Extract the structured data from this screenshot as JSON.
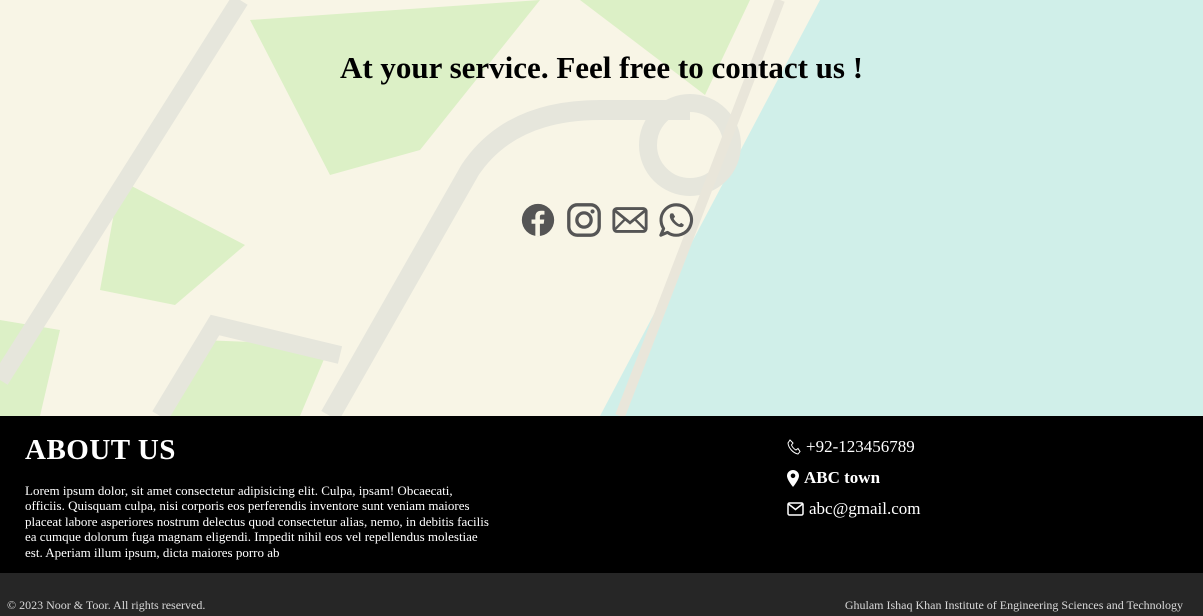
{
  "hero": {
    "title": "At your service. Feel free to contact us !"
  },
  "social": [
    {
      "name": "facebook",
      "icon": "facebook-icon"
    },
    {
      "name": "instagram",
      "icon": "instagram-icon"
    },
    {
      "name": "email",
      "icon": "envelope-icon"
    },
    {
      "name": "whatsapp",
      "icon": "whatsapp-icon"
    }
  ],
  "about": {
    "title": "ABOUT US",
    "text": "Lorem ipsum dolor, sit amet consectetur adipisicing elit. Culpa, ipsam! Obcaecati, officiis. Quisquam culpa, nisi corporis eos perferendis inventore sunt veniam maiores placeat labore asperiores nostrum delectus quod consectetur alias, nemo, in debitis facilis ea cumque dolorum fuga magnam eligendi. Impedit nihil eos vel repellendus molestiae est. Aperiam illum ipsum, dicta maiores porro ab"
  },
  "contact": {
    "phone": "+92-123456789",
    "address": "ABC town",
    "email": "abc@gmail.com"
  },
  "footer": {
    "copyright": "© 2023 Noor & Toor. All rights reserved.",
    "institute": "Ghulam Ishaq Khan Institute of Engineering Sciences and Technology"
  },
  "colors": {
    "map_land": "#f8f5e6",
    "map_park": "#dcf0c6",
    "map_water": "#d0efe9",
    "map_road": "#e6e6dc",
    "icon": "#555555",
    "footer_main": "#000000",
    "footer_bottom": "#262626"
  }
}
